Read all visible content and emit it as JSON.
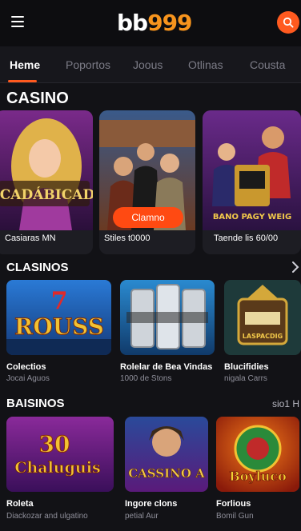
{
  "header": {
    "logo_main": "bb",
    "logo_accent": "999",
    "menu_icon": "hamburger-icon",
    "search_icon": "search-icon",
    "accent_color": "#ff5a1f"
  },
  "nav": {
    "tabs": [
      {
        "label": "Heme",
        "active": true
      },
      {
        "label": "Poportos",
        "active": false
      },
      {
        "label": "Joous",
        "active": false
      },
      {
        "label": "Otlinas",
        "active": false
      },
      {
        "label": "Cousta",
        "active": false
      }
    ]
  },
  "casino": {
    "title": "CASINO",
    "cards": [
      {
        "art_text": "ICADÁBICAD",
        "caption": "Casiaras MN"
      },
      {
        "button": "Clamno",
        "caption": "Stiles t0000"
      },
      {
        "art_text": "BANO PAGY WEIG",
        "caption": "Taende lis 60/00"
      }
    ]
  },
  "clasinos": {
    "title": "CLASINOS",
    "arrow_icon": "chevron-right-icon",
    "tiles": [
      {
        "art_text": "ROUSS",
        "art_num": "7",
        "title": "Colectios",
        "sub": "Jocai Aguos"
      },
      {
        "title": "Rolelar de Bea Vindas",
        "sub": "1000 de Stons"
      },
      {
        "art_text": "LASPACDIG",
        "title": "Blucifidies",
        "sub": "nigala Carrs"
      }
    ]
  },
  "baisinos": {
    "title": "BAISINOS",
    "link": "sio1 H",
    "tiles": [
      {
        "art_text": "Chaluguis",
        "art_num": "30",
        "title": "Roleta",
        "sub": "Diackozar and ulgatino"
      },
      {
        "art_text": "CASSINO A",
        "title": "Ingore clons",
        "sub": "petial Aur"
      },
      {
        "art_text": "Boyluco",
        "title": "Forlious",
        "sub": "Bomil Gun"
      }
    ]
  }
}
